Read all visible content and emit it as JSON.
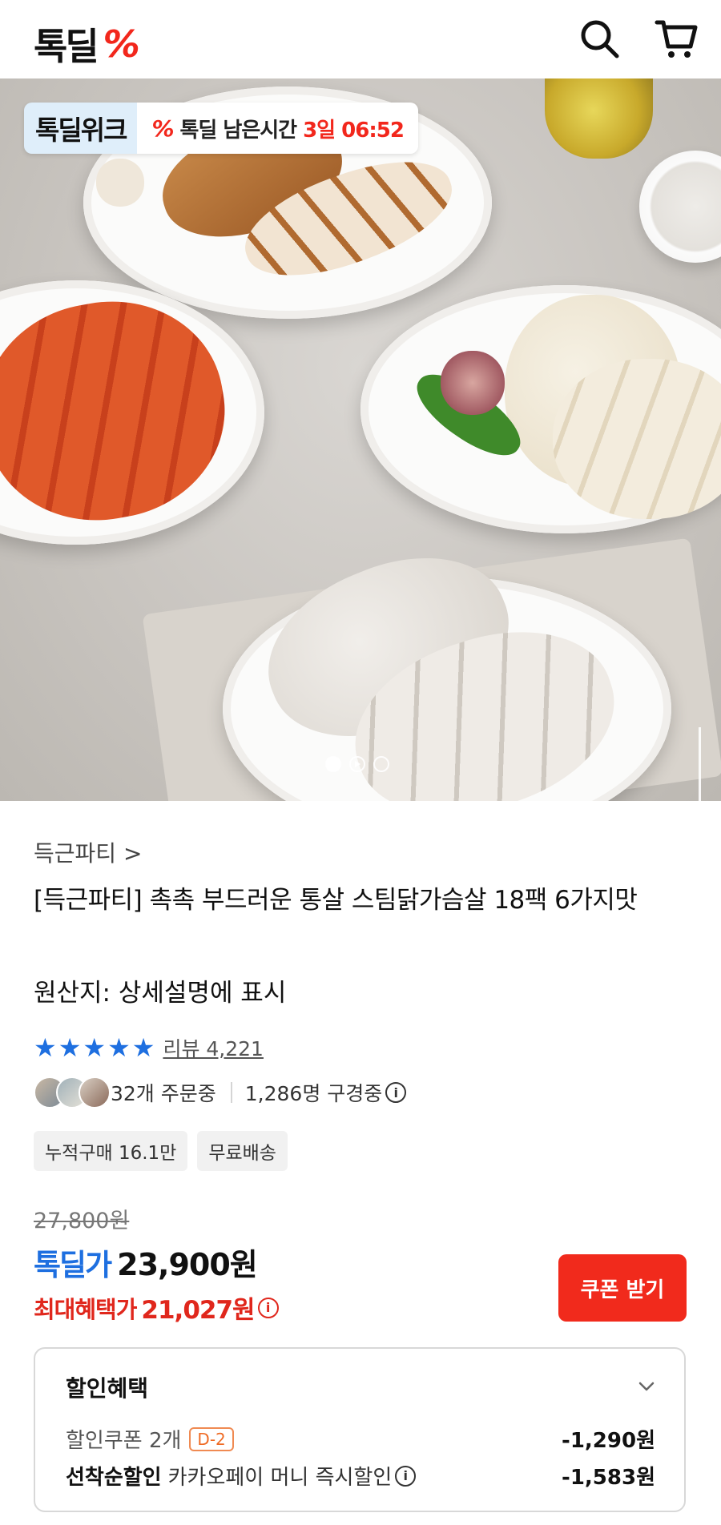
{
  "header": {
    "logo_text": "톡딜",
    "logo_mark": "%",
    "icons": [
      "search-icon",
      "cart-icon"
    ]
  },
  "hero": {
    "badge_left": "톡딜위크",
    "badge_mark": "%",
    "badge_label": "톡딜 남은시간",
    "badge_time": "3일 06:52",
    "carousel_pages": 3,
    "carousel_active": 1
  },
  "product": {
    "brand": "득근파티 >",
    "title": "[득근파티] 촉촉 부드러운 통살 스팀닭가슴살 18팩 6가지맛",
    "origin": "원산지: 상세설명에 표시",
    "rating_stars": 5,
    "review": "리뷰 4,221",
    "ordering": "32개 주문중",
    "viewing": "1,286명 구경중",
    "chips": [
      "누적구매 16.1만",
      "무료배송"
    ]
  },
  "price": {
    "original": "27,800원",
    "deal_label": "톡딜가",
    "deal_price": "23,900원",
    "max_label": "최대혜택가",
    "max_price": "21,027원",
    "coupon_button": "쿠폰 받기"
  },
  "benefit": {
    "title": "할인혜택",
    "row1_label": "할인쿠폰 2개",
    "row1_badge": "D-2",
    "row1_amount": "-1,290원",
    "row2_bold": "선착순할인",
    "row2_label": "카카오페이 머니 즉시할인",
    "row2_amount": "-1,583원"
  },
  "colors": {
    "brand_red": "#f2271c",
    "deal_blue": "#1e6fe0"
  }
}
